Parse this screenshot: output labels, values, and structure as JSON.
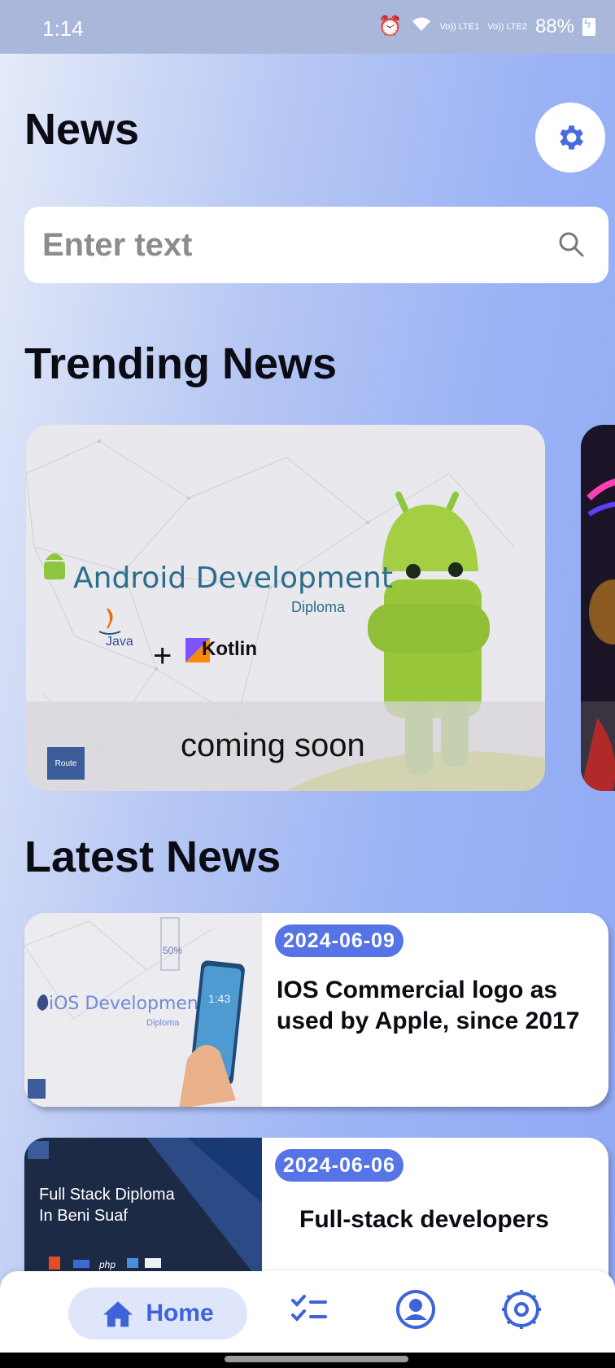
{
  "status_bar": {
    "time": "1:14",
    "battery": "88%",
    "sim1": "Vo)) LTE1",
    "sim2": "Vo)) LTE2"
  },
  "header": {
    "title": "News",
    "settings_icon": "gear-icon"
  },
  "search": {
    "placeholder": "Enter text",
    "icon": "search-icon"
  },
  "trending": {
    "section_title": "Trending News",
    "cards": [
      {
        "brand": "Android Development",
        "brand_sub": "Diploma",
        "java": "Java",
        "plus": "+",
        "kotlin": "Kotlin",
        "route_logo": "Route",
        "caption": "coming soon"
      }
    ]
  },
  "latest": {
    "section_title": "Latest News",
    "items": [
      {
        "date": "2024-06-09",
        "headline": "IOS Commercial logo as used by Apple, since 2017",
        "thumb_text": "iOS Development",
        "thumb_sub": "Diploma",
        "thumb_badge": "50%",
        "thumb_clock": "1:43"
      },
      {
        "date": "2024-06-06",
        "headline": "Full-stack developers",
        "thumb_text_1": "Full Stack Diploma",
        "thumb_text_2": "In Beni Suaf",
        "thumb_php": "php"
      }
    ]
  },
  "bottom_nav": {
    "home_label": "Home",
    "icons": [
      "home-icon",
      "checklist-icon",
      "profile-icon",
      "settings-icon"
    ]
  },
  "colors": {
    "accent": "#3f63d8",
    "date_badge": "#5674e6",
    "nav_active_bg": "#dfe5fa"
  }
}
